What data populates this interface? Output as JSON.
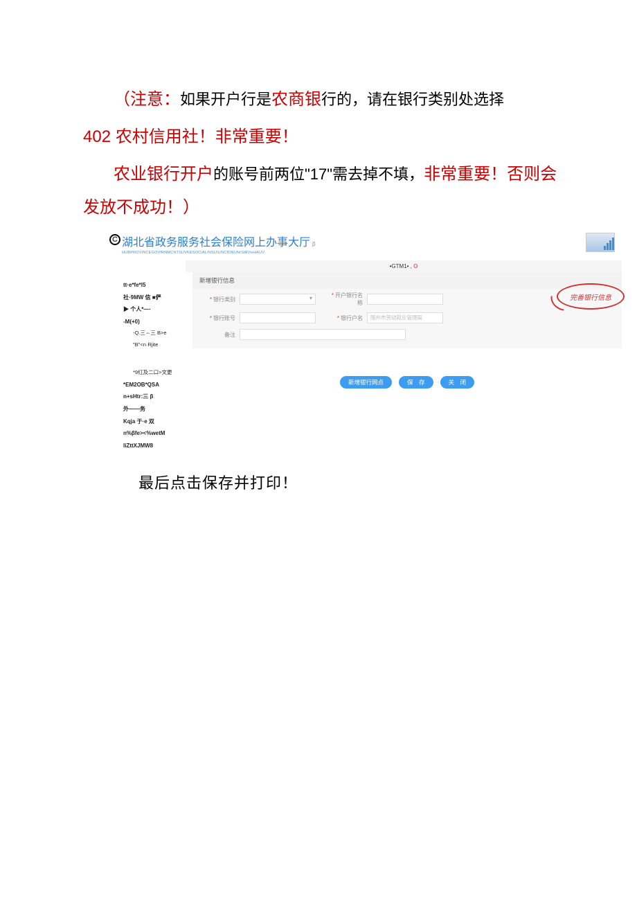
{
  "instructions": {
    "note_label": "（注意：",
    "p1_mid": "如果开户行是",
    "p1_bank": "农商银",
    "p1_after_bank": "行的，",
    "p1_tail": "请在银行类别处选择",
    "p2": "402 农村信用社！非常重要！",
    "p3_a": "农业银行开户",
    "p3_b": "的账号前两位\"17\"需去掉不填，",
    "p3_c": "非常重要！否则会发放不成功！）"
  },
  "screenshot": {
    "logo_text": "C",
    "title": "湖北省政务服务社会保险网上办事大厅",
    "beta": "β",
    "subtitle": "HUBPROVINCEGOVfRNMCNTSUVKESOCIALINSUIUNCfONUNrStRVieHAUV",
    "topbar_pre": "•GTM1• ,",
    "topbar_icon": "O",
    "sidebar": {
      "i1": "tt·e*fe*l5",
      "i2": "社·9MW 信 ■俨",
      "i3": "▶ 个人*—·",
      "i4": "-M(+0)",
      "i4a": "-Q.三⇔三 B>e",
      "i4b": "\"B\"<n·Rjite",
      "i5": "*9红及二口>文更",
      "i6": "*EM2OB*QSA",
      "i7": "n+sHtr:三 β",
      "i8": "外——务",
      "i9": "Kqja 于·e 双",
      "i10": "n%βfe><%wetM",
      "i11": "liZttXJMW8"
    },
    "form": {
      "section_title": "新增银行信息",
      "bank_type": "银行类别",
      "bank_name": "开户银行名称",
      "account_no": "银行账号",
      "account_name": "银行户名",
      "account_name_ph": "随州市劳动就业管理局",
      "remark": "备注"
    },
    "cta": "完善银行信息",
    "buttons": {
      "b1": "新增银行网点",
      "b2": "保　存",
      "b3": "关　闭"
    }
  },
  "final": "最后点击保存并打印！"
}
